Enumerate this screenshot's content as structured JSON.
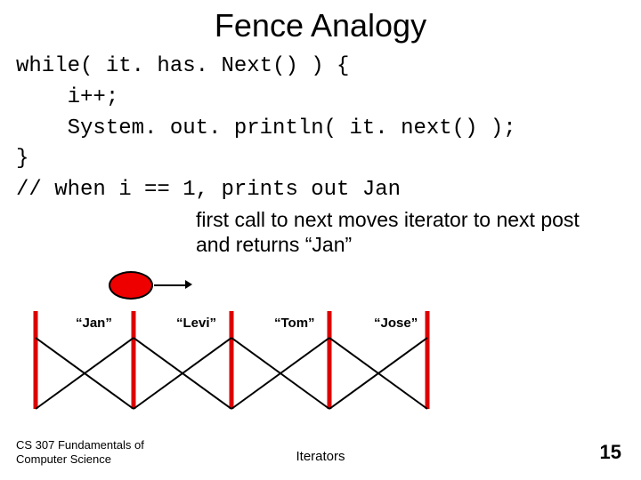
{
  "title": "Fence Analogy",
  "code": {
    "l1": "while( it. has. Next() ) {",
    "l2": "    i++;",
    "l3": "    System. out. println( it. next() );",
    "l4": "}",
    "l5": "// when i == 1, prints out Jan"
  },
  "explain": "first call to next moves iterator to next post and returns “Jan”",
  "fence": {
    "labels": [
      "“Jan”",
      "“Levi”",
      "“Tom”",
      "“Jose”"
    ]
  },
  "footer": {
    "course_l1": "CS 307 Fundamentals of",
    "course_l2": "Computer Science",
    "topic": "Iterators",
    "page": "15"
  }
}
